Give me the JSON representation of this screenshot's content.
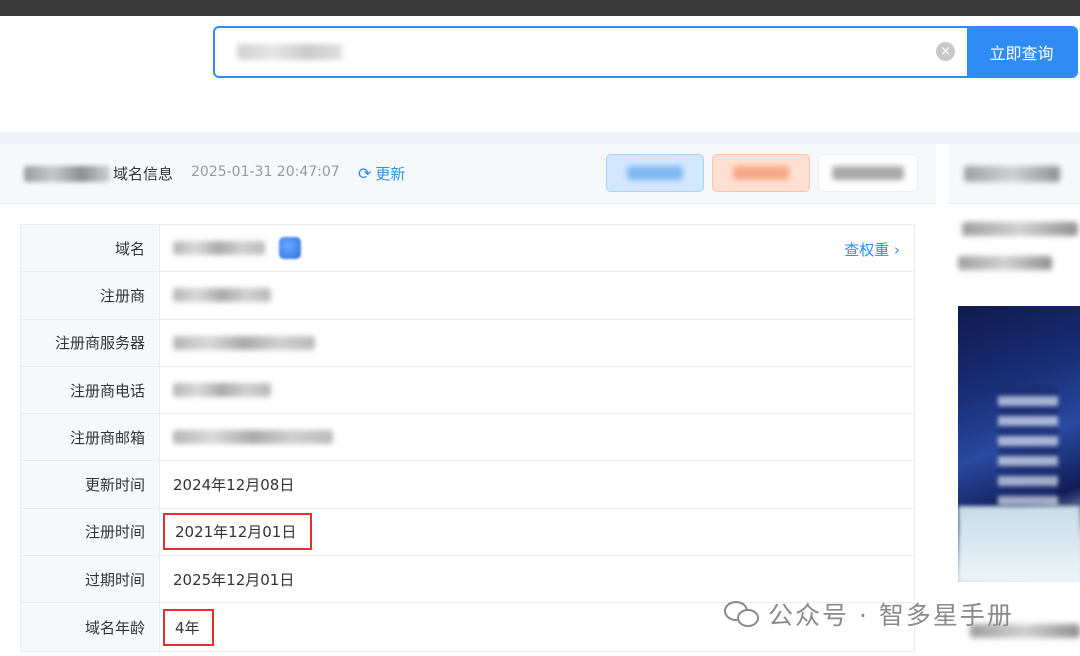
{
  "search": {
    "placeholder": "",
    "button_label": "立即查询",
    "clear_icon": "clear-icon"
  },
  "header": {
    "title_suffix": "域名信息",
    "timestamp": "2025-01-31 20:47:07",
    "refresh_label": "更新",
    "refresh_icon": "refresh-icon"
  },
  "rows": [
    {
      "label": "域名",
      "value": "",
      "link": "查权重 ›"
    },
    {
      "label": "注册商",
      "value": ""
    },
    {
      "label": "注册商服务器",
      "value": ""
    },
    {
      "label": "注册商电话",
      "value": ""
    },
    {
      "label": "注册商邮箱",
      "value": ""
    },
    {
      "label": "更新时间",
      "value": "2024年12月08日"
    },
    {
      "label": "注册时间",
      "value": "2021年12月01日"
    },
    {
      "label": "过期时间",
      "value": "2025年12月01日"
    },
    {
      "label": "域名年龄",
      "value": "4年"
    }
  ],
  "watermark": {
    "text": "公众号 · 智多星手册",
    "icon": "wechat-icon"
  },
  "colors": {
    "accent": "#2f8cf5",
    "highlight": "#e03232",
    "label_bg": "#f6f9fc"
  }
}
